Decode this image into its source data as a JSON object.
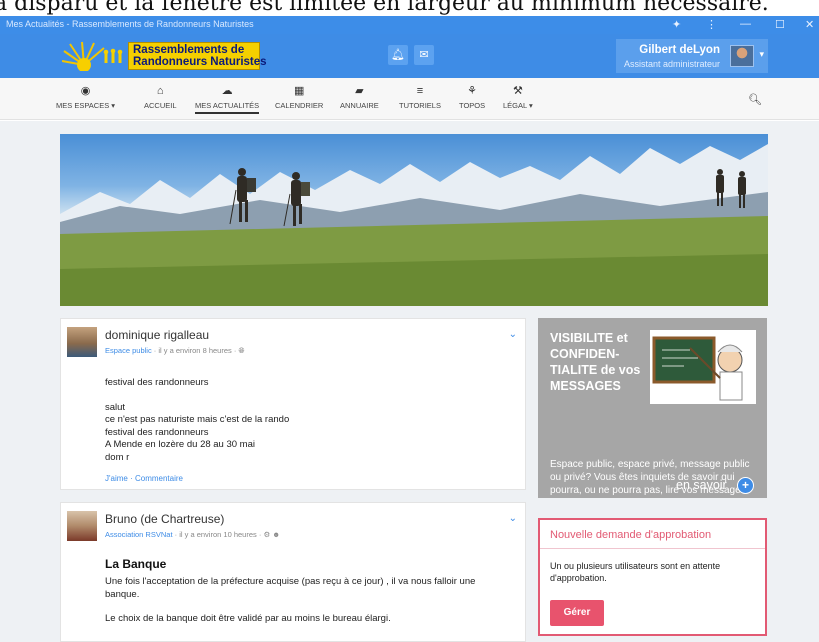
{
  "caption_text": "a disparu et la fenêtre est limitée en largeur au minimum nécessaire.",
  "window": {
    "title": "Mes Actualités - Rassemblements de Randonneurs Naturistes",
    "controls": [
      "✦",
      "⋮",
      "—",
      "☐",
      "✕"
    ]
  },
  "header": {
    "logo_line1": "Rassemblements de",
    "logo_line2": "Randonneurs Naturistes",
    "notif_icon": "bell-icon",
    "mail_icon": "mail-icon",
    "user_name": "Gilbert deLyon",
    "user_role": "Assistant administrateur"
  },
  "nav": {
    "items": [
      {
        "label": "MES ESPACES ▾",
        "icon": "◉",
        "active": false
      },
      {
        "label": "ACCUEIL",
        "icon": "⌂",
        "active": false
      },
      {
        "label": "MES ACTUALITÉS",
        "icon": "☁",
        "active": true
      },
      {
        "label": "CALENDRIER",
        "icon": "▦",
        "active": false
      },
      {
        "label": "ANNUAIRE",
        "icon": "▰",
        "active": false
      },
      {
        "label": "TUTORIELS",
        "icon": "≡",
        "active": false
      },
      {
        "label": "TOPOS",
        "icon": "⚘",
        "active": false
      },
      {
        "label": "LÉGAL ▾",
        "icon": "⚒",
        "active": false
      }
    ],
    "search_icon": "search-icon"
  },
  "posts": [
    {
      "author": "dominique rigalleau",
      "space": "Espace public",
      "time": "· il y a environ 8 heures ·",
      "lines": [
        "festival des randonneurs",
        "",
        "salut",
        "ce n'est pas naturiste mais c'est de la rando",
        "festival des randonneurs",
        "A Mende en lozère du 28 au 30 mai",
        "dom r"
      ],
      "actions": "J'aime  · Commentaire"
    },
    {
      "author": "Bruno (de Chartreuse)",
      "space": "Association RSVNat",
      "time": "· il y a environ 10 heures ·",
      "title": "La Banque",
      "lines": [
        "Une fois l'acceptation de la préfecture acquise (pas reçu à ce jour) , il va nous falloir une",
        "banque.",
        "",
        "Le choix de la banque doit être validé par au moins le bureau élargi."
      ]
    }
  ],
  "promo": {
    "title": "VISIBILITE et CONFIDEN-TIALITE de vos MESSAGES",
    "text": "Espace public, espace privé, message public ou privé? Vous êtes inquiets de savoir qui pourra, ou ne pourra pas, lire vos messages. Des explicati nous occuper une soiré",
    "more": "en savoir",
    "plus": "+"
  },
  "approval": {
    "title": "Nouvelle demande d'approbation",
    "body": "Un ou plusieurs utilisateurs sont en attente d'approbation.",
    "button": "Gérer"
  }
}
